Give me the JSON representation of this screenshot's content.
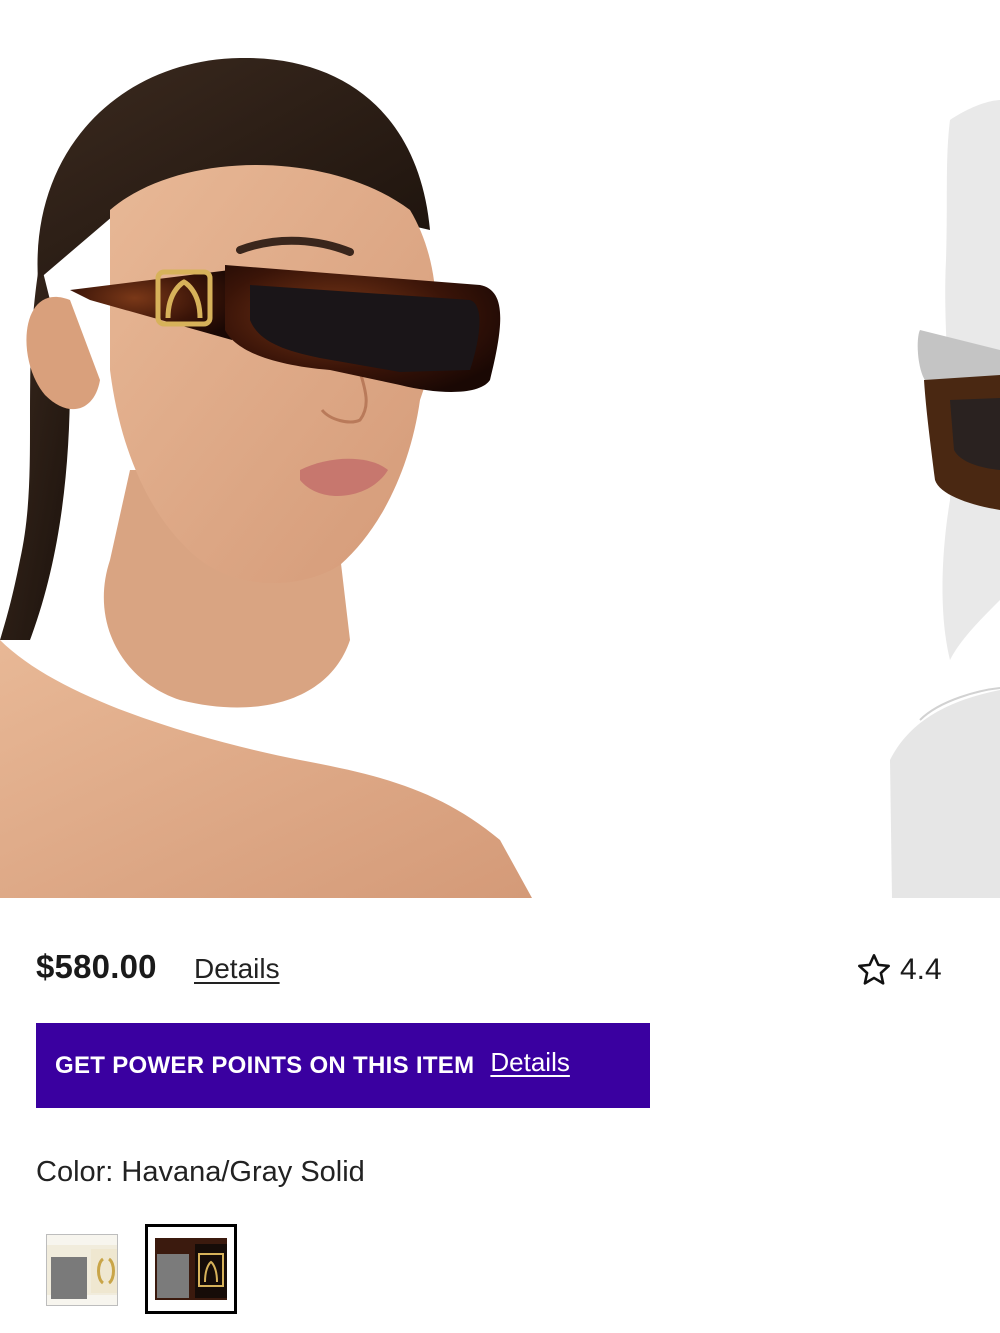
{
  "gallery": {
    "images": [
      {
        "icon": "model-wearing-sunglasses-image"
      },
      {
        "icon": "mannequin-wearing-sunglasses-image"
      }
    ]
  },
  "product": {
    "price": "$580.00",
    "price_details_link": "Details",
    "rating": "4.4",
    "rating_icon": "star-outline-icon"
  },
  "promo": {
    "text": "GET POWER POINTS ON THIS ITEM",
    "details_link": "Details",
    "background": "#3a00a0"
  },
  "color": {
    "label": "Color: Havana/Gray Solid",
    "swatches": [
      {
        "name": "ivory-frame-swatch",
        "selected": false
      },
      {
        "name": "havana-frame-swatch",
        "selected": true
      }
    ]
  }
}
